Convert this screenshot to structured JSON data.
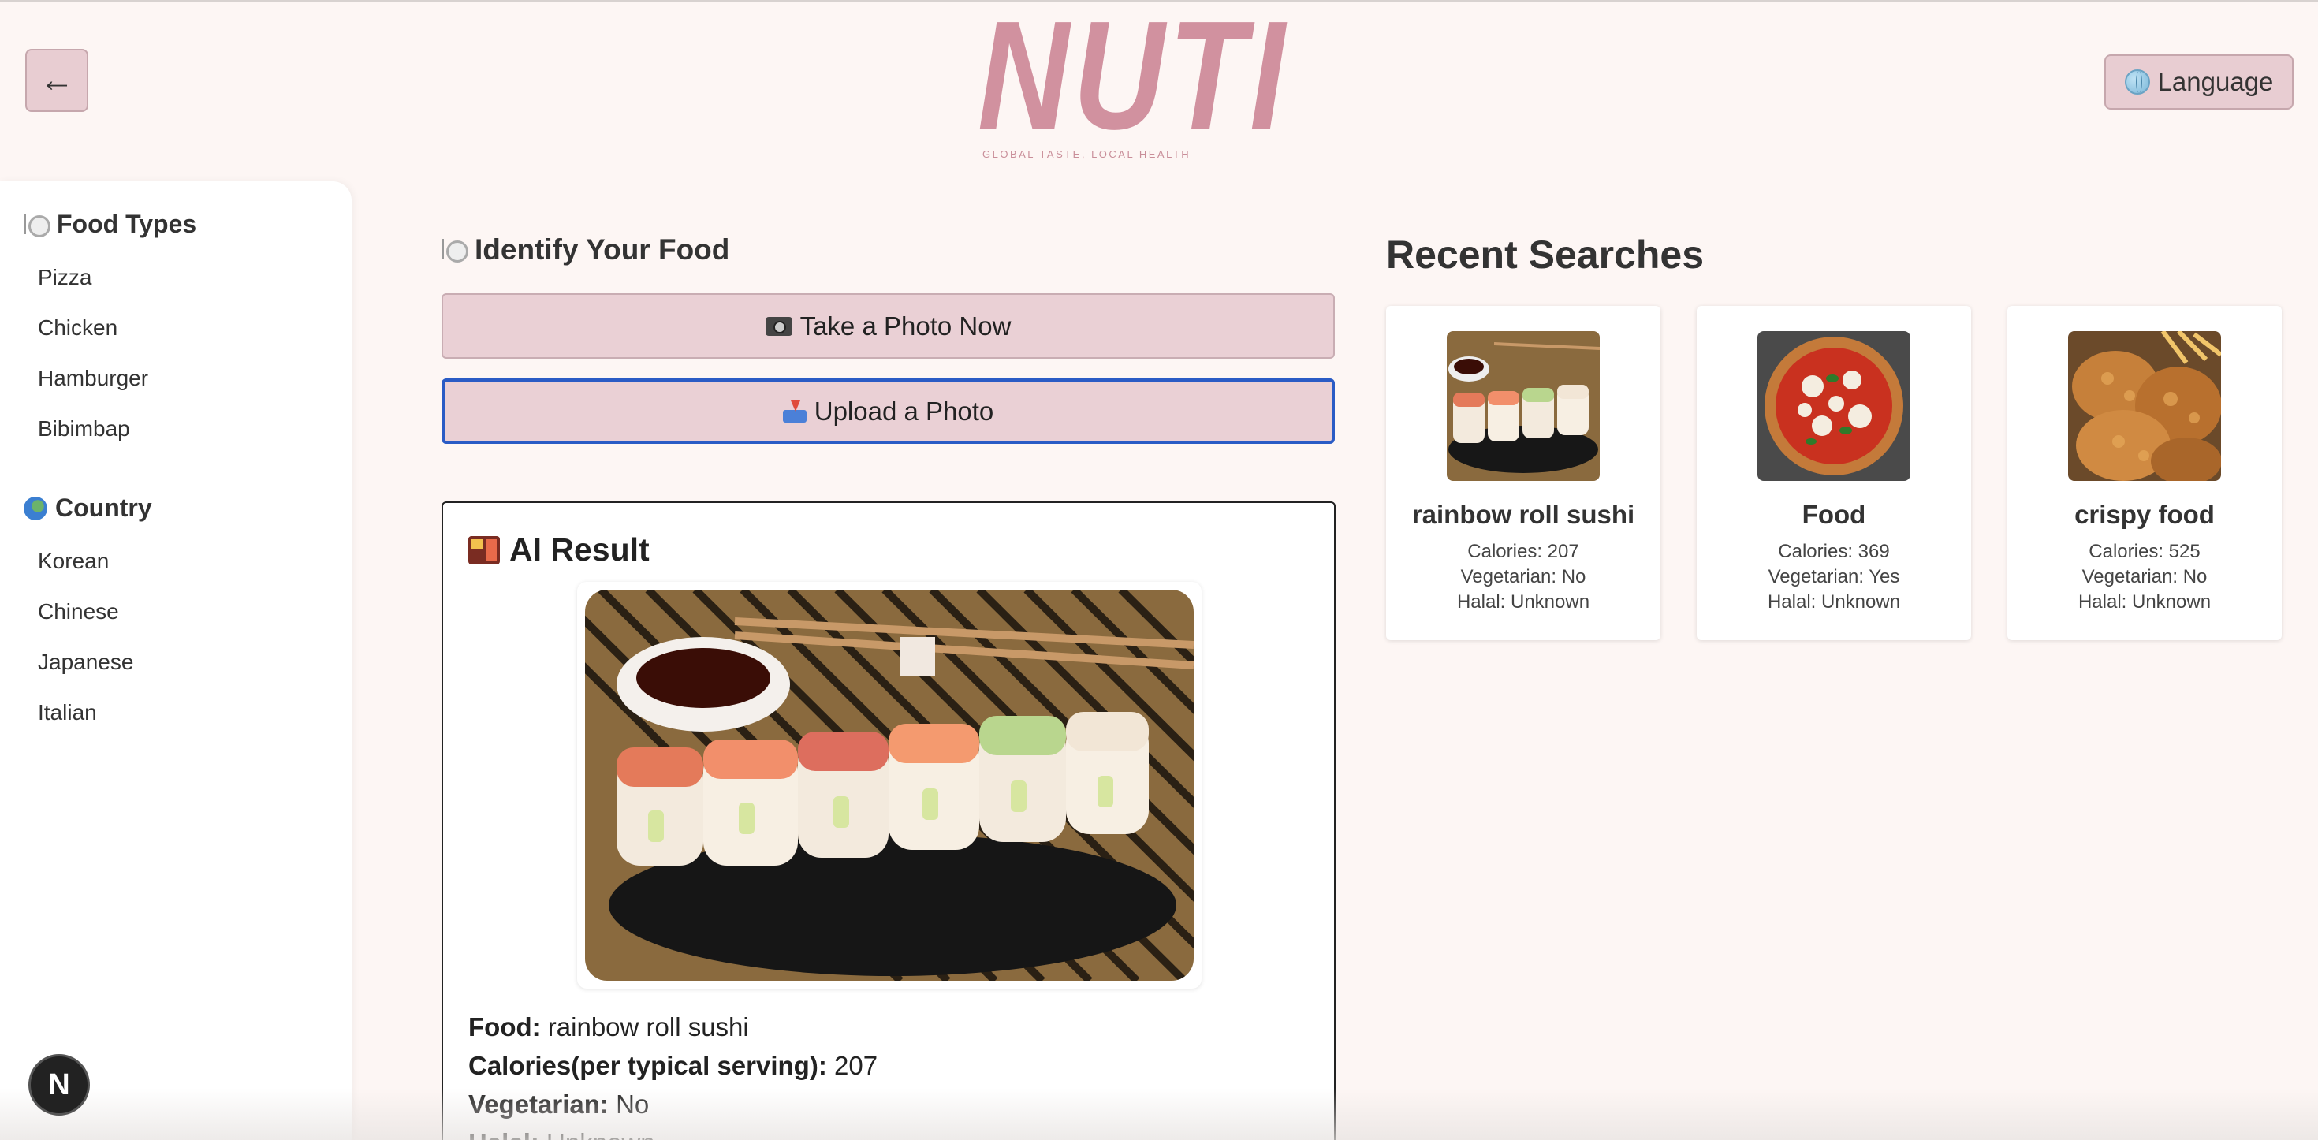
{
  "header": {
    "back_label": "←",
    "logo_text": "NUTI",
    "tagline": "GLOBAL TASTE, LOCAL HEALTH",
    "language_label": "Language"
  },
  "sidebar": {
    "food_types": {
      "title": "Food Types",
      "items": [
        "Pizza",
        "Chicken",
        "Hamburger",
        "Bibimbap"
      ]
    },
    "country": {
      "title": "Country",
      "items": [
        "Korean",
        "Chinese",
        "Japanese",
        "Italian"
      ]
    }
  },
  "identify": {
    "title": "Identify Your Food",
    "take_photo_label": "Take a Photo Now",
    "upload_photo_label": "Upload a Photo"
  },
  "ai_result": {
    "title": "AI Result",
    "food_label": "Food:",
    "food_value": " rainbow roll sushi",
    "calories_label": "Calories(per typical serving):",
    "calories_value": " 207",
    "vegetarian_label": "Vegetarian:",
    "vegetarian_value": " No",
    "halal_label": "Halal:",
    "halal_value": " Unknown"
  },
  "recent": {
    "title": "Recent Searches",
    "cards": [
      {
        "name": "rainbow roll sushi",
        "calories": "Calories: 207",
        "vegetarian": "Vegetarian: No",
        "halal": "Halal: Unknown"
      },
      {
        "name": "Food",
        "calories": "Calories: 369",
        "vegetarian": "Vegetarian: Yes",
        "halal": "Halal: Unknown"
      },
      {
        "name": "crispy food",
        "calories": "Calories: 525",
        "vegetarian": "Vegetarian: No",
        "halal": "Halal: Unknown"
      }
    ]
  },
  "badge": {
    "label": "N"
  },
  "colors": {
    "background": "#fdf6f4",
    "button_pink": "#ead0d5",
    "logo_pink": "#d1919f",
    "focus_blue": "#2a5bc5"
  }
}
